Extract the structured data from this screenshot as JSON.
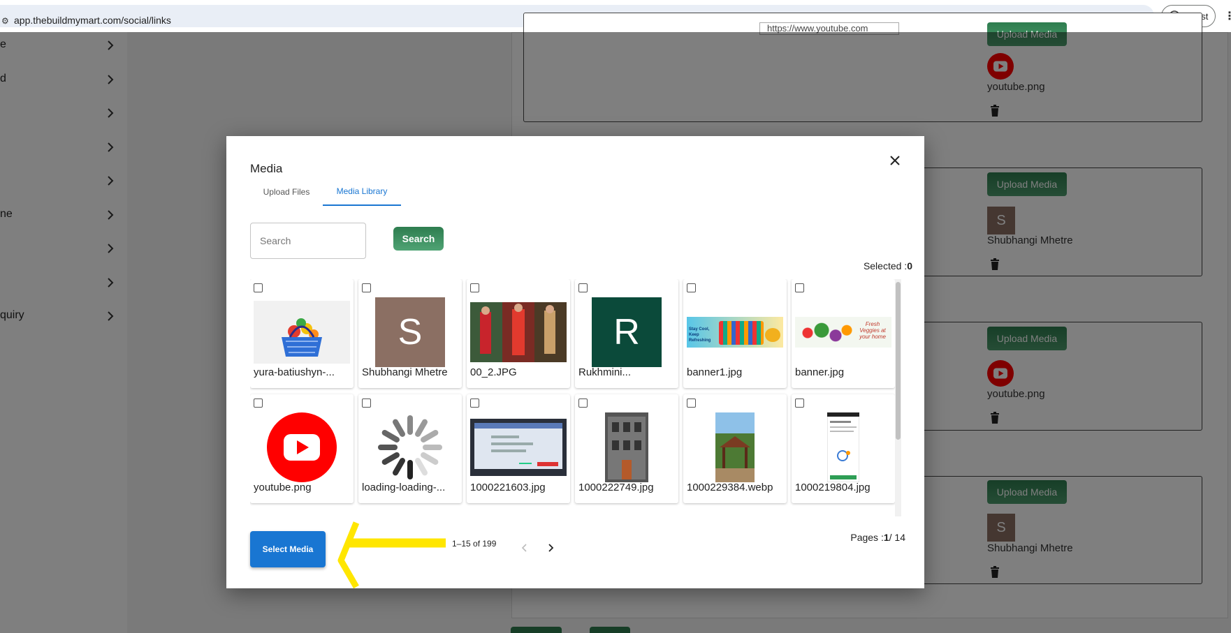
{
  "browser": {
    "url": "app.thebuildmymart.com/social/links",
    "profile_label": "Guest"
  },
  "sidebar": {
    "items": [
      {
        "label": "e"
      },
      {
        "label": "d"
      },
      {
        "label": ""
      },
      {
        "label": ""
      },
      {
        "label": ""
      },
      {
        "label": "ne"
      },
      {
        "label": ""
      },
      {
        "label": ""
      },
      {
        "label": "quiry"
      }
    ]
  },
  "background": {
    "url_input_value": "https://www.youtube.com",
    "upload_label": "Upload Media",
    "rows": [
      {
        "caption": "youtube.png"
      },
      {
        "caption": "Shubhangi Mhetre",
        "avatar_letter": "S"
      },
      {
        "caption": "youtube.png"
      },
      {
        "caption": "Shubhangi Mhetre",
        "avatar_letter": "S"
      }
    ]
  },
  "modal": {
    "title": "Media",
    "tabs": [
      {
        "label": "Upload Files",
        "active": false
      },
      {
        "label": "Media Library",
        "active": true
      }
    ],
    "search": {
      "placeholder": "Search",
      "button_label": "Search"
    },
    "selected": {
      "label": "Selected :",
      "count": "0"
    },
    "items": [
      {
        "name": "yura-batiushyn-...",
        "thumb": "basket"
      },
      {
        "name": "Shubhangi Mhetre",
        "thumb": "letter",
        "letter": "S",
        "color": "#8b6f63"
      },
      {
        "name": "00_2.JPG",
        "thumb": "photo-people"
      },
      {
        "name": "Rukhmini...",
        "thumb": "letter",
        "letter": "R",
        "color": "#0b4a3a"
      },
      {
        "name": "banner1.jpg",
        "thumb": "banner-drinks",
        "banner_text": "Stay Cool, Keep Refreshing"
      },
      {
        "name": "banner.jpg",
        "thumb": "banner-veggies",
        "banner_text": "Fresh Veggies at your home"
      },
      {
        "name": "youtube.png",
        "thumb": "youtube"
      },
      {
        "name": "loading-loading-...",
        "thumb": "spinner"
      },
      {
        "name": "1000221603.jpg",
        "thumb": "screen-photo"
      },
      {
        "name": "1000222749.jpg",
        "thumb": "building-photo"
      },
      {
        "name": "1000229384.webp",
        "thumb": "gazebo-photo"
      },
      {
        "name": "1000219804.jpg",
        "thumb": "phone-screenshot"
      }
    ],
    "select_button_label": "Select Media",
    "pagination": {
      "range": "1–15 of 199",
      "pages_label": "Pages :",
      "current": "1",
      "total": "/ 14"
    }
  },
  "colors": {
    "primary_blue": "#1976d2",
    "green": "#2e7d4f",
    "youtube_red": "#ff0000",
    "annotation_yellow": "#ffe600"
  }
}
